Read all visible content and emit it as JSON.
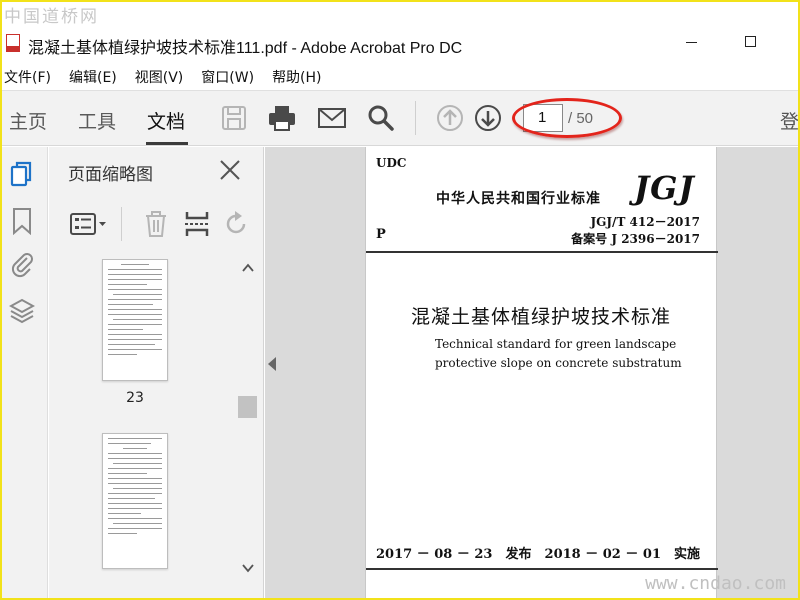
{
  "watermarks": {
    "top": "中国道桥网",
    "bottom": "www.cndao.com"
  },
  "window": {
    "title": "混凝土基体植绿护坡技术标准111.pdf - Adobe Acrobat Pro DC"
  },
  "menu": [
    "文件(F)",
    "编辑(E)",
    "视图(V)",
    "窗口(W)",
    "帮助(H)"
  ],
  "toolbar": {
    "tabs": {
      "home": "主页",
      "tools": "工具",
      "document": "文档"
    },
    "page_current": "1",
    "page_total": "/ 50",
    "signin": "登"
  },
  "thumbnails_panel": {
    "title": "页面缩略图",
    "pages": [
      {
        "label": "23"
      }
    ]
  },
  "document_page": {
    "udc": "UDC",
    "standard_type": "中华人民共和国行业标准",
    "logo": "JGJ",
    "code": "JGJ/T 412－2017",
    "record_no": "备案号 J 2396－2017",
    "category": "P",
    "title_cn": "混凝土基体植绿护坡技术标准",
    "title_en_line1": "Technical standard for green landscape",
    "title_en_line2": "protective slope on concrete substratum",
    "issued": "2017 － 08 － 23　发布",
    "implemented": "2018 － 02 － 01　实施"
  },
  "colors": {
    "annotation_red": "#e3241b",
    "frame_yellow": "#f2e21a",
    "acrobat_red": "#c9302c",
    "icon_gray": "#4a4a4a",
    "disabled_gray": "#b5b5b5"
  }
}
